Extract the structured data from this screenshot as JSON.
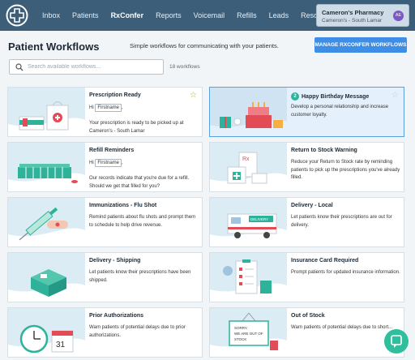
{
  "nav": {
    "links": [
      "Inbox",
      "Patients",
      "RxConfer",
      "Reports",
      "Voicemail",
      "Refills",
      "Leads",
      "Resources"
    ],
    "active": "RxConfer",
    "pharmacy_name": "Cameron's Pharmacy",
    "pharmacy_location": "Cameron's - South Lamar",
    "avatar_initials": "AE"
  },
  "header": {
    "title": "Patient Workflows",
    "subtitle": "Simple workflows for communicating with your patients.",
    "manage_button": "MANAGE RXCONFER WORKFLOWS"
  },
  "search": {
    "placeholder": "Search available workflows...",
    "count": "18 workflows"
  },
  "cards": [
    {
      "title": "Prescription Ready",
      "pre": "Hi",
      "tag": "Firstname",
      "post": ",",
      "desc": "Your prescription is ready to be picked up at Cameron's - South Lamar",
      "icon": "prescription-bag-icon",
      "starred": true
    },
    {
      "title": "Happy Birthday Message",
      "number": "2",
      "desc": "Develop a personal relationship and increase customer loyalty.",
      "icon": "birthday-cake-icon",
      "selected": true,
      "starred": false
    },
    {
      "title": "Refill Reminders",
      "pre": "Hi",
      "tag": "Firstname",
      "post": ",",
      "desc": "Our records indicate that you're due for a refill. Should we get that filled for you?",
      "icon": "pill-organizer-icon"
    },
    {
      "title": "Return to Stock Warning",
      "desc": "Reduce your Return to Stock rate by reminding patients to pick up the prescriptions you've already filled.",
      "icon": "return-box-icon"
    },
    {
      "title": "Immunizations - Flu Shot",
      "desc": "Remind patients about flu shots and prompt them to schedule to help drive revenue.",
      "icon": "syringe-icon"
    },
    {
      "title": "Delivery - Local",
      "desc": "Let patients know their prescriptions are out for delivery.",
      "icon": "delivery-van-icon"
    },
    {
      "title": "Delivery - Shipping",
      "desc": "Let patients know their prescriptions have been shipped.",
      "icon": "package-icon"
    },
    {
      "title": "Insurance Card Required",
      "desc": "Prompt patients for updated insurance information.",
      "icon": "clipboard-icon"
    },
    {
      "title": "Prior Authorizations",
      "desc": "Warn patients of potential delays due to prior authorizations.",
      "icon": "clock-calendar-icon"
    },
    {
      "title": "Out of Stock",
      "desc": "Warn patients of potential delays due to short...",
      "sign": "SORRY, WE ARE OUT OF STOCK",
      "icon": "out-of-stock-sign-icon"
    }
  ],
  "calendar_day": "31",
  "colors": {
    "nav": "#3d5e78",
    "accent": "#3f8ee6",
    "teal": "#2fb29a",
    "selected": "#e4f0fb"
  }
}
